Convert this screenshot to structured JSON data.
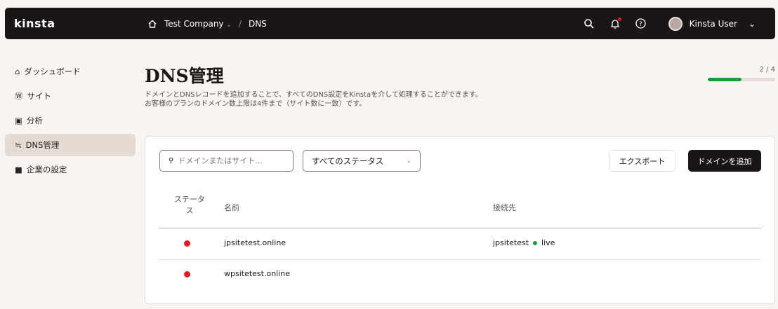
{
  "header": {
    "logo": "kinsta",
    "company": "Test Company",
    "current": "DNS",
    "user": "Kinsta User",
    "separator": "/"
  },
  "sidebar": {
    "items": [
      {
        "label": "ダッシュボード",
        "icon": "home-icon"
      },
      {
        "label": "サイト",
        "icon": "wordpress-icon"
      },
      {
        "label": "分析",
        "icon": "chart-icon"
      },
      {
        "label": "DNS管理",
        "icon": "dns-icon",
        "active": true
      },
      {
        "label": "企業の設定",
        "icon": "briefcase-icon"
      }
    ]
  },
  "page": {
    "title": "DNS管理",
    "desc1": "ドメインとDNSレコードを追加することで、すべてのDNS設定をKinstaを介して処理することができます。",
    "desc2": "お客様のプランのドメイン数上限は4件まで（サイト数に一致）です。",
    "usage_label": "2 / 4",
    "usage_fraction": 0.5
  },
  "toolbar": {
    "search_placeholder": "ドメインまたはサイト...",
    "status_select": "すべてのステータス",
    "export": "エクスポート",
    "add": "ドメインを追加"
  },
  "table": {
    "headers": [
      "ステータス",
      "名前",
      "接続先"
    ],
    "rows": [
      {
        "status": "error",
        "name": "jpsitetest.online",
        "site": "jpsitetest",
        "env": "live"
      },
      {
        "status": "error",
        "name": "wpsitetest.online",
        "site": "",
        "env": ""
      }
    ]
  }
}
